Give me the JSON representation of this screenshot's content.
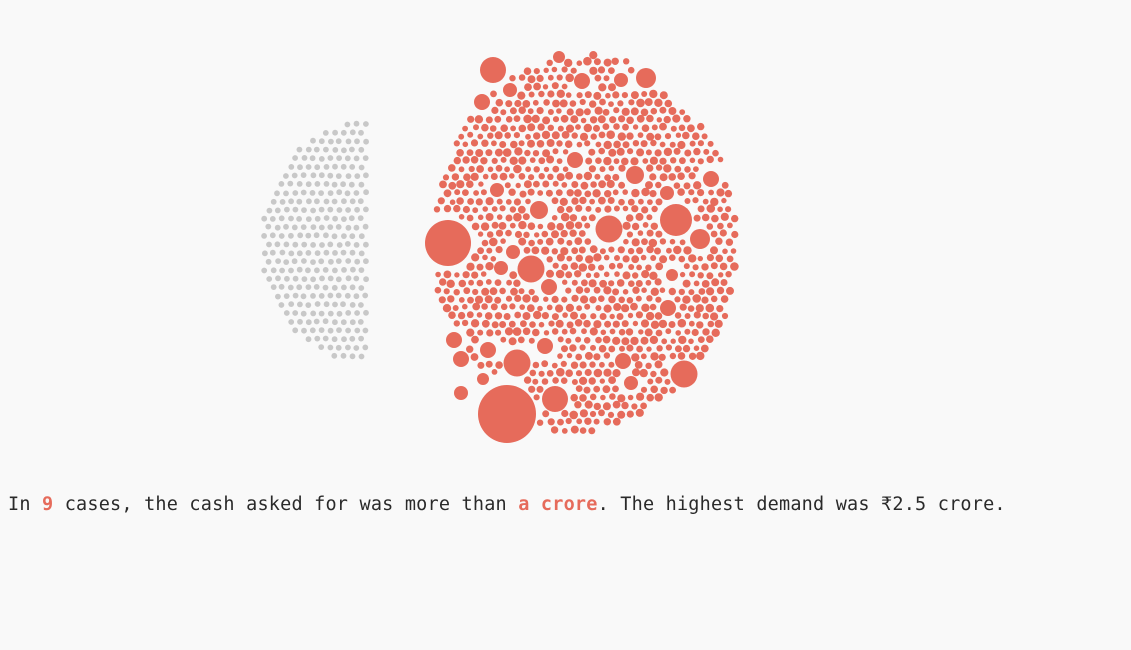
{
  "colors": {
    "accent": "#e66b5b",
    "muted": "#c8c8c8",
    "text": "#2a2a2a",
    "background": "#f9f9f9"
  },
  "caption": {
    "prefix": "In ",
    "count": "9",
    "middle": " cases, the cash asked for was more than ",
    "threshold": "a crore",
    "suffix": ". The highest demand was ₹2.5 crore."
  },
  "chart_data": {
    "type": "bubble-cluster",
    "groups": [
      {
        "name": "",
        "color": "#c8c8c8",
        "approx_cases": 250
      },
      {
        "name": "",
        "color": "#e66b5b",
        "approx_cases": 1100
      }
    ],
    "cases_above_one_crore": 9,
    "highest_demand_crore": 2.5
  }
}
